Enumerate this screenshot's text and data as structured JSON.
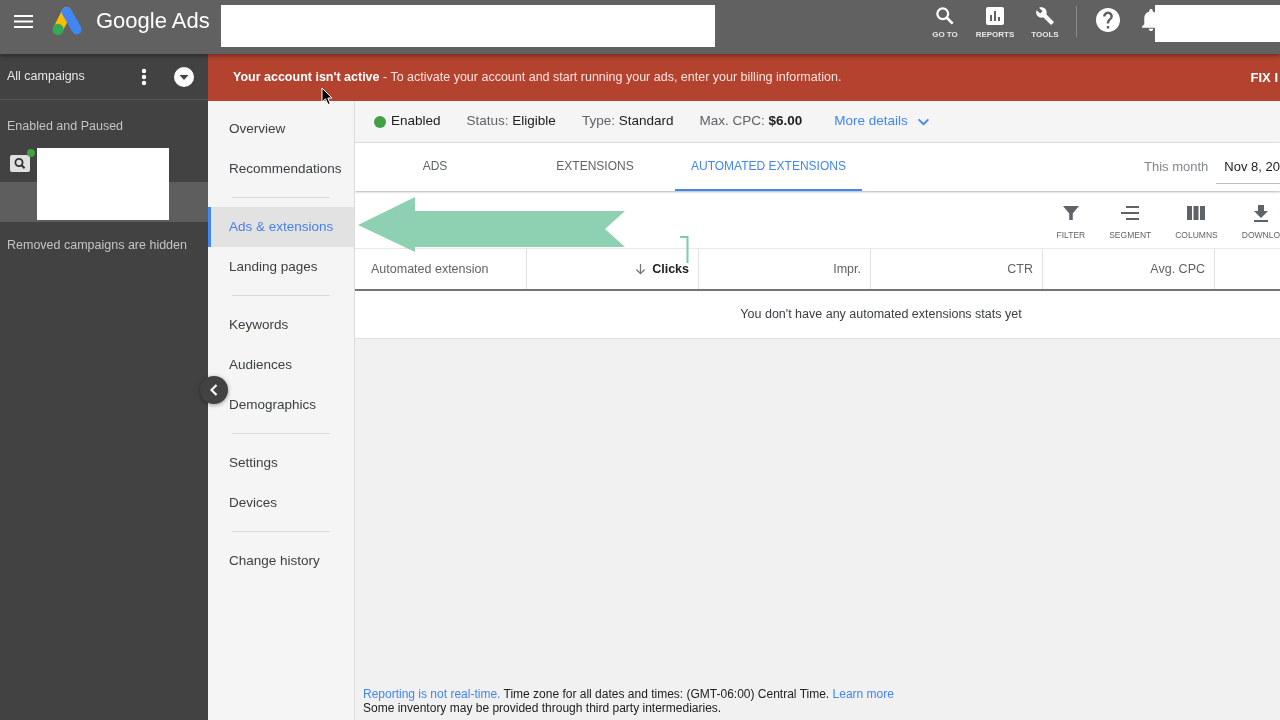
{
  "top_bar": {
    "title": "Google Ads",
    "actions": [
      {
        "kind": "search",
        "label": "GO TO"
      },
      {
        "kind": "reports",
        "label": "REPORTS"
      },
      {
        "kind": "tools",
        "label": "TOOLS"
      }
    ]
  },
  "sidebar": {
    "title": "All campaigns",
    "filter": "Enabled and Paused",
    "note": "Removed campaigns are hidden"
  },
  "banner": {
    "message": "**Your account isn't active** - To activate your account and start running your ads, enter your billing information.",
    "action": "FIX I"
  },
  "nav": {
    "groups": [
      {
        "items": [
          {
            "label": "Overview",
            "selected": false
          },
          {
            "label": "Recommendations",
            "selected": false
          }
        ]
      },
      {
        "items": [
          {
            "label": "Ads & extensions",
            "selected": true
          },
          {
            "label": "Landing pages",
            "selected": false
          }
        ]
      },
      {
        "items": [
          {
            "label": "Keywords",
            "selected": false
          },
          {
            "label": "Audiences",
            "selected": false
          },
          {
            "label": "Demographics",
            "selected": false
          }
        ]
      },
      {
        "items": [
          {
            "label": "Settings",
            "selected": false
          },
          {
            "label": "Devices",
            "selected": false
          }
        ]
      },
      {
        "items": [
          {
            "label": "Change history",
            "selected": false
          }
        ]
      }
    ]
  },
  "summary": {
    "state": "Enabled",
    "fields": [
      {
        "label": "Status:",
        "value": "Eligible",
        "strong": false
      },
      {
        "label": "Type:",
        "value": "Standard",
        "strong": false
      },
      {
        "label": "Max. CPC:",
        "value": "$6.00",
        "strong": true
      }
    ],
    "more": "More details"
  },
  "tabs": [
    {
      "label": "ADS",
      "selected": false
    },
    {
      "label": "EXTENSIONS",
      "selected": false
    },
    {
      "label": "AUTOMATED EXTENSIONS",
      "selected": true
    }
  ],
  "date_range": {
    "label": "This month",
    "value": "Nov 8, 20"
  },
  "toolbar": [
    {
      "kind": "filter",
      "label": "FILTER"
    },
    {
      "kind": "segment",
      "label": "SEGMENT"
    },
    {
      "kind": "columns",
      "label": "COLUMNS"
    },
    {
      "kind": "download",
      "label": "DOWNLO"
    }
  ],
  "table": {
    "columns": [
      {
        "label": "Automated extension",
        "sorted": false
      },
      {
        "label": "Clicks",
        "sorted": true
      },
      {
        "label": "Impr.",
        "sorted": false
      },
      {
        "label": "CTR",
        "sorted": false
      },
      {
        "label": "Avg. CPC",
        "sorted": false
      }
    ],
    "empty_message": "You don't have any automated extensions stats yet"
  },
  "footer": {
    "lines": [
      {
        "parts": [
          {
            "kind": "link",
            "text": "Reporting is not real-time."
          },
          {
            "kind": "text",
            "text": "Time zone for all dates and times: (GMT-06:00) Central Time."
          },
          {
            "kind": "link",
            "text": "Learn more"
          }
        ]
      },
      {
        "parts": [
          {
            "kind": "text",
            "text": "Some inventory may be provided through third party intermediaries."
          }
        ]
      }
    ]
  }
}
